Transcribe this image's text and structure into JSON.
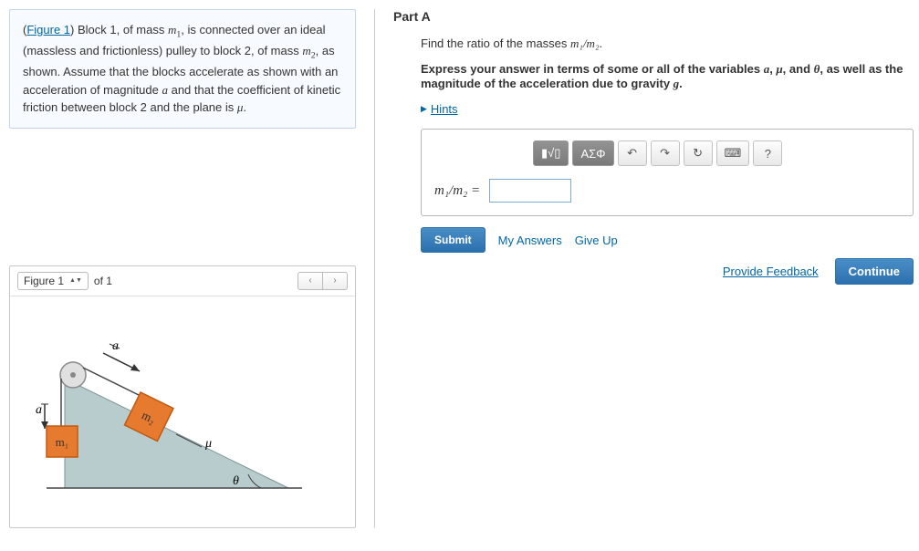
{
  "problem": {
    "figure_link": "Figure 1",
    "text_pre": "(",
    "text_post_link": ") Block 1, of mass ",
    "m1": "m",
    "m1_sub": "1",
    "seg2": ", is connected over an ideal (massless and frictionless) pulley to block 2, of mass ",
    "m2": "m",
    "m2_sub": "2",
    "seg3": ", as shown. Assume that the blocks accelerate as shown with an acceleration of magnitude ",
    "a": "a",
    "seg4": " and that the coefficient of kinetic friction between block 2 and the plane is ",
    "mu": "μ",
    "seg5": "."
  },
  "figure": {
    "selector_label": "Figure 1",
    "of_label": "of 1",
    "prev_icon": "‹",
    "next_icon": "›"
  },
  "diagram": {
    "m1": "m₁",
    "m2": "m₂",
    "mu": "μ",
    "theta": "θ",
    "a": "a"
  },
  "partA": {
    "label": "Part A",
    "instruction_pre": "Find the ratio of the masses ",
    "ratio": "m₁/m₂",
    "instruction_post": ".",
    "express_pre": "Express your answer in terms of some or all of the variables ",
    "va": "a",
    "sep1": ", ",
    "vmu": "μ",
    "sep2": ", and ",
    "vth": "θ",
    "express_mid": ", as well as the magnitude of the acceleration due to gravity ",
    "vg": "g",
    "express_post": ".",
    "hints_label": "Hints"
  },
  "toolbar": {
    "templates": "▮√▯",
    "greek": "ΑΣΦ",
    "undo": "↶",
    "redo": "↷",
    "reset": "↻",
    "keyboard": "⌨",
    "help": "?"
  },
  "answer": {
    "label": "m₁/m₂ ="
  },
  "buttons": {
    "submit": "Submit",
    "my_answers": "My Answers",
    "give_up": "Give Up",
    "provide_feedback": "Provide Feedback",
    "continue": "Continue"
  }
}
